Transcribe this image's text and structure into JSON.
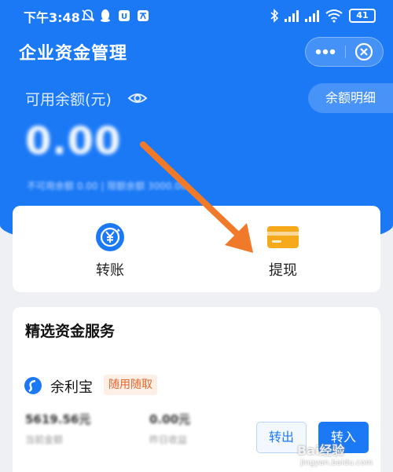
{
  "status_bar": {
    "time": "下午3:48",
    "battery": "41"
  },
  "header": {
    "title": "企业资金管理",
    "balance_label": "可用余额(元)",
    "detail_button": "余额明细",
    "balance_amount": "0.00",
    "subline": "不可用余额  0.00  |  限额余额  3000.00"
  },
  "actions": [
    {
      "label": "转账",
      "icon": "yuan-transfer-icon"
    },
    {
      "label": "提现",
      "icon": "card-icon"
    }
  ],
  "services": {
    "title": "精选资金服务",
    "product": {
      "name": "余利宝",
      "badge": "随用随取",
      "amount_value": "5619.56元",
      "amount_label": "当前金额",
      "income_value": "0.00元",
      "income_label": "昨日收益",
      "out_button": "转出",
      "in_button": "转入"
    }
  },
  "watermark": {
    "text": "Bai经验",
    "sub": "jingyan.baidu.com"
  },
  "colors": {
    "primary": "#1b79f6",
    "arrow": "#f07a2a",
    "badge_bg": "#fdeee6",
    "badge_text": "#e0662a"
  }
}
